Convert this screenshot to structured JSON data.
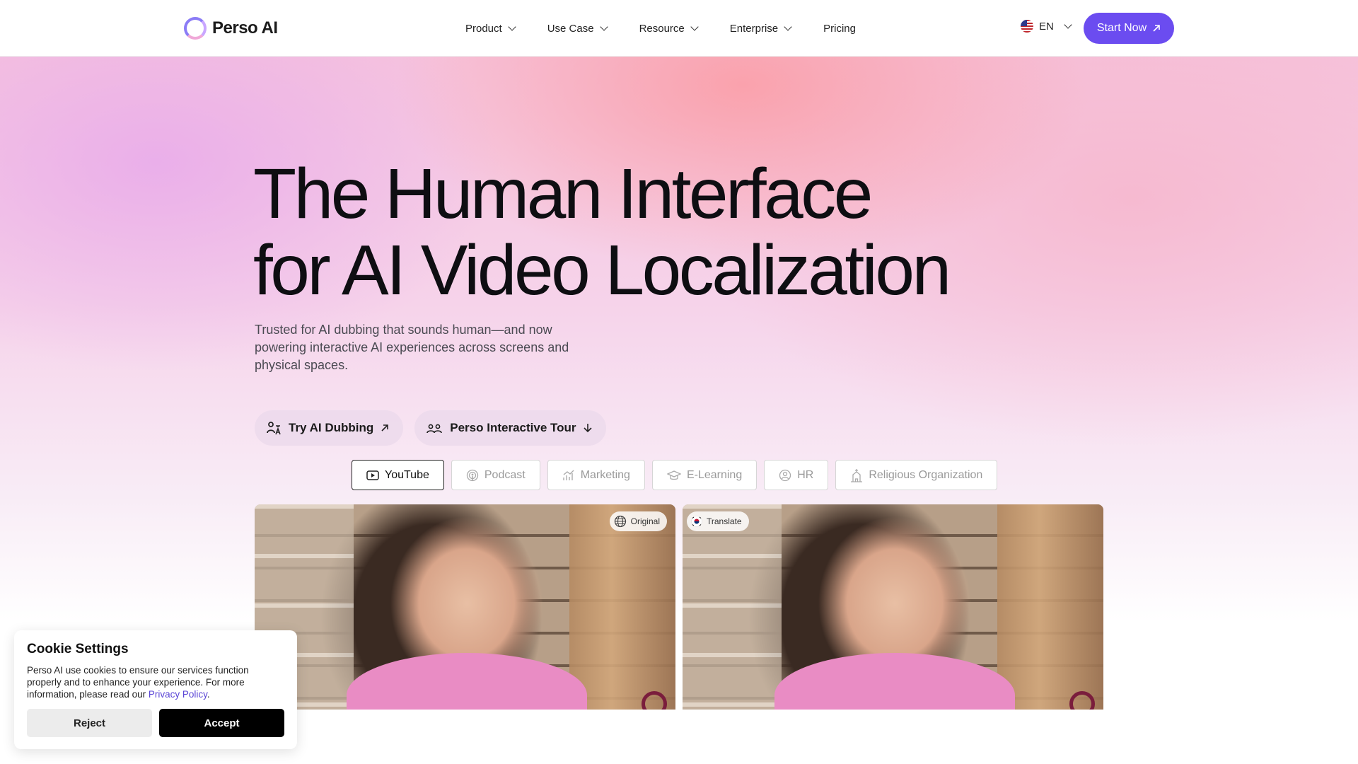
{
  "header": {
    "logo_text": "Perso AI",
    "nav": [
      {
        "label": "Product",
        "has_menu": true
      },
      {
        "label": "Use Case",
        "has_menu": true
      },
      {
        "label": "Resource",
        "has_menu": true
      },
      {
        "label": "Enterprise",
        "has_menu": true
      },
      {
        "label": "Pricing",
        "has_menu": false
      }
    ],
    "language": "EN",
    "start_label": "Start Now"
  },
  "hero": {
    "headline_line1": "The Human Interface",
    "headline_line2": "for AI Video Localization",
    "subtitle": "Trusted for AI dubbing that sounds human—and now powering interactive AI experiences across screens and physical spaces.",
    "cta_primary": "Try AI Dubbing",
    "cta_secondary": "Perso Interactive Tour"
  },
  "tabs": [
    {
      "label": "YouTube",
      "icon": "youtube-icon",
      "active": true
    },
    {
      "label": "Podcast",
      "icon": "podcast-icon",
      "active": false
    },
    {
      "label": "Marketing",
      "icon": "chart-icon",
      "active": false
    },
    {
      "label": "E-Learning",
      "icon": "graduation-cap-icon",
      "active": false
    },
    {
      "label": "HR",
      "icon": "person-icon",
      "active": false
    },
    {
      "label": "Religious Organization",
      "icon": "church-icon",
      "active": false
    }
  ],
  "videos": {
    "original_label": "Original",
    "translate_label": "Translate"
  },
  "cookie": {
    "title": "Cookie Settings",
    "text": "Perso AI use cookies to ensure our services function properly and to enhance your experience. For more information, please read our",
    "link_text": "Privacy Policy",
    "reject_label": "Reject",
    "accept_label": "Accept"
  },
  "colors": {
    "brand_purple": "#6b4cf0",
    "link_purple": "#5a45d6"
  }
}
